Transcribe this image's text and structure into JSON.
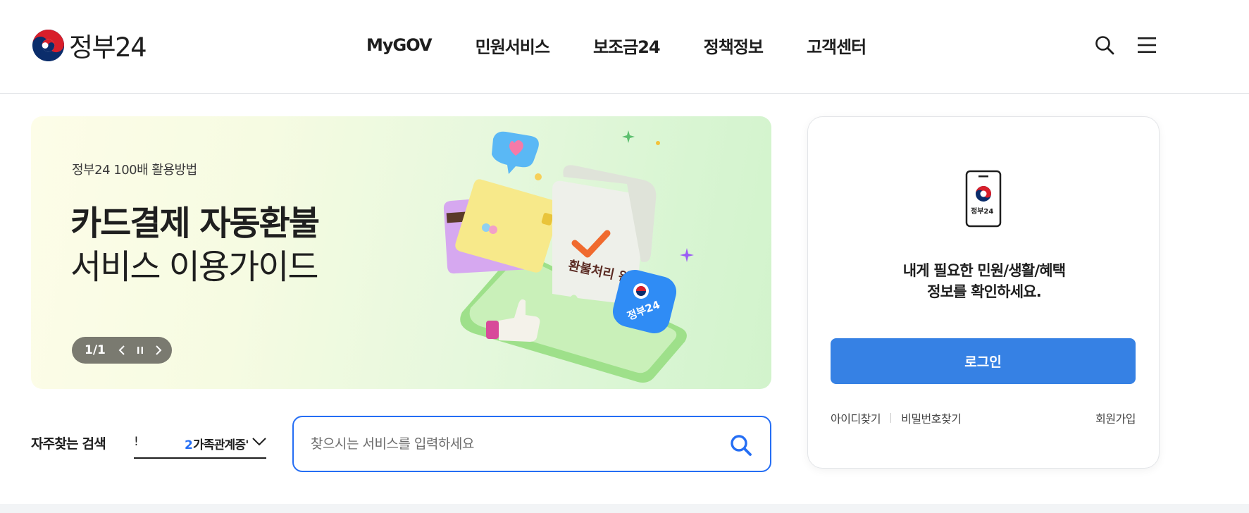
{
  "header": {
    "logo_text": "정부24",
    "nav": [
      "MyGOV",
      "민원서비스",
      "보조금24",
      "정책정보",
      "고객센터"
    ],
    "search_icon": "search-icon",
    "menu_icon": "hamburger-menu-icon"
  },
  "banner": {
    "eyebrow": "정부24 100배 활용방법",
    "title_line1": "카드결제 자동환불",
    "title_line2": "서비스 이용가이드",
    "art_label": "환불처리 완료",
    "badge_text": "정부24",
    "slide_count": "1/1",
    "controls": [
      "prev-icon",
      "pause-icon",
      "next-icon"
    ]
  },
  "login": {
    "phone_label": "정부24",
    "message_line1": "내게 필요한 민원/생활/혜택",
    "message_line2": "정보를 확인하세요.",
    "login_button": "로그인",
    "find_id": "아이디찾기",
    "find_password": "비밀번호찾기",
    "signup": "회원가입"
  },
  "frequent_search": {
    "label": "자주찾는 검색",
    "prev_fragment": "!",
    "current_rank": "2",
    "current_text": "가족관계증'"
  },
  "search": {
    "placeholder": "찾으시는 서비스를 입력하세요",
    "value": ""
  },
  "colors": {
    "primary_blue": "#256ef4",
    "login_button": "#3681e4",
    "slider_pill": "#7a7a70"
  }
}
